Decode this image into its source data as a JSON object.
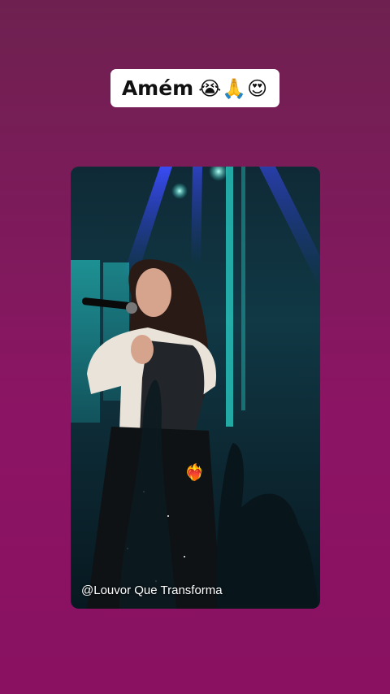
{
  "caption": {
    "text": "Amém",
    "emojis": "😭🙏😍"
  },
  "story": {
    "watermark": "@Louvor Que Transforma",
    "sticker_emoji": "❤️‍🔥"
  },
  "colors": {
    "background_top": "#6e2150",
    "background_bottom": "#8a1162",
    "stage_light_blue": "#2a3fd8",
    "stage_cyan": "#25c4c4"
  }
}
